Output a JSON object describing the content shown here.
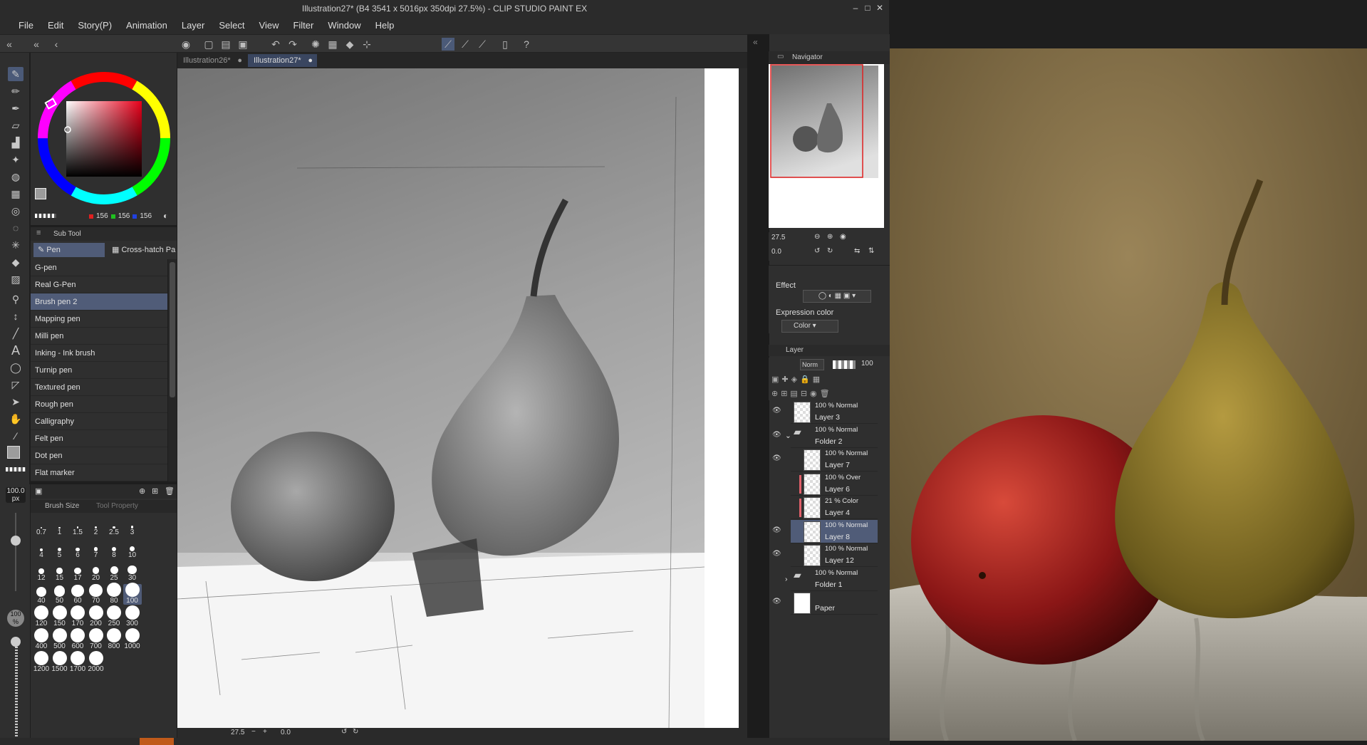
{
  "window": {
    "title": "Illustration27* (B4 3541 x 5016px 350dpi 27.5%) - CLIP STUDIO PAINT EX"
  },
  "menu": [
    "File",
    "Edit",
    "Story(P)",
    "Animation",
    "Layer",
    "Select",
    "View",
    "Filter",
    "Window",
    "Help"
  ],
  "color": {
    "r": "156",
    "g": "156",
    "b": "156",
    "accent": "#d0303a"
  },
  "subtool": {
    "header": "Sub Tool",
    "tabs": [
      "Pen",
      "Cross-hatch Pa"
    ],
    "brushes": [
      "G-pen",
      "Real G-Pen",
      "Brush pen 2",
      "Mapping pen",
      "Milli pen",
      "Inking - Ink brush",
      "Turnip pen",
      "Textured pen",
      "Rough pen",
      "Calligraphy",
      "Felt pen",
      "Dot pen",
      "Flat marker"
    ],
    "selected_index": 2
  },
  "brush_size": {
    "tabs": [
      "Brush Size",
      "Tool Property"
    ],
    "current": "100.0",
    "unit": "px",
    "opacity": "100",
    "opacity_unit": "%",
    "sizes": [
      "0.7",
      "1",
      "1.5",
      "2",
      "2.5",
      "3",
      "4",
      "5",
      "6",
      "7",
      "8",
      "10",
      "12",
      "15",
      "17",
      "20",
      "25",
      "30",
      "40",
      "50",
      "60",
      "70",
      "80",
      "100",
      "120",
      "150",
      "170",
      "200",
      "250",
      "300",
      "400",
      "500",
      "600",
      "700",
      "800",
      "1000",
      "1200",
      "1500",
      "1700",
      "2000"
    ],
    "selected": "100"
  },
  "documents": [
    {
      "name": "Illustration26*",
      "active": false
    },
    {
      "name": "Illustration27*",
      "active": true
    }
  ],
  "canvas_status": {
    "zoom": "27.5",
    "angle": "0.0"
  },
  "navigator": {
    "label": "Navigator",
    "zoom": "27.5",
    "rotation": "0.0"
  },
  "property": {
    "effect_label": "Effect",
    "expression_label": "Expression color",
    "expression_value": "Color"
  },
  "layer_panel": {
    "label": "Layer",
    "blend": "Norm",
    "opacity": "100",
    "layers": [
      {
        "mode": "100 % Normal",
        "name": "Layer 3",
        "indent": 0,
        "type": "raster",
        "visible": true
      },
      {
        "mode": "100 % Normal",
        "name": "Folder 2",
        "indent": 0,
        "type": "folder-open",
        "visible": true
      },
      {
        "mode": "100 % Normal",
        "name": "Layer 7",
        "indent": 1,
        "type": "raster",
        "visible": true
      },
      {
        "mode": "100 % Over",
        "name": "Layer 6",
        "indent": 1,
        "type": "clip",
        "visible": false
      },
      {
        "mode": "21 % Color",
        "name": "Layer 4",
        "indent": 1,
        "type": "clip",
        "visible": false
      },
      {
        "mode": "100 % Normal",
        "name": "Layer 8",
        "indent": 1,
        "type": "raster",
        "visible": true,
        "selected": true
      },
      {
        "mode": "100 % Normal",
        "name": "Layer 12",
        "indent": 1,
        "type": "raster",
        "visible": true
      },
      {
        "mode": "100 % Normal",
        "name": "Folder 1",
        "indent": 0,
        "type": "folder-closed",
        "visible": false
      },
      {
        "mode": "",
        "name": "Paper",
        "indent": 0,
        "type": "paper",
        "visible": true
      }
    ]
  }
}
